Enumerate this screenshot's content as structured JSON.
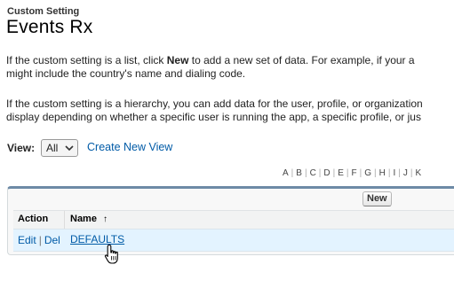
{
  "header": {
    "subtitle": "Custom Setting",
    "title": "Events Rx"
  },
  "description": {
    "p1_a": "If the custom setting is a list, click ",
    "p1_bold": "New",
    "p1_b": " to add a new set of data. For example, if your a",
    "p1_line2": "might include the country's name and dialing code.",
    "p2_line1": "If the custom setting is a hierarchy, you can add data for the user, profile, or organization",
    "p2_line2": "display depending on whether a specific user is running the app, a specific profile, or jus"
  },
  "view": {
    "label": "View:",
    "selected": "All",
    "create_link": "Create New View"
  },
  "alpha_filter": [
    "A",
    "B",
    "C",
    "D",
    "E",
    "F",
    "G",
    "H",
    "I",
    "J",
    "K"
  ],
  "list": {
    "new_button": "New",
    "columns": {
      "action": "Action",
      "name": "Name",
      "sort_indicator": "↑"
    },
    "rows": [
      {
        "edit": "Edit",
        "del": "Del",
        "name": "DEFAULTS"
      }
    ]
  },
  "colors": {
    "link": "#015ba7",
    "panel_border": "#6d8aa6",
    "row_highlight": "#e3f3ff"
  }
}
